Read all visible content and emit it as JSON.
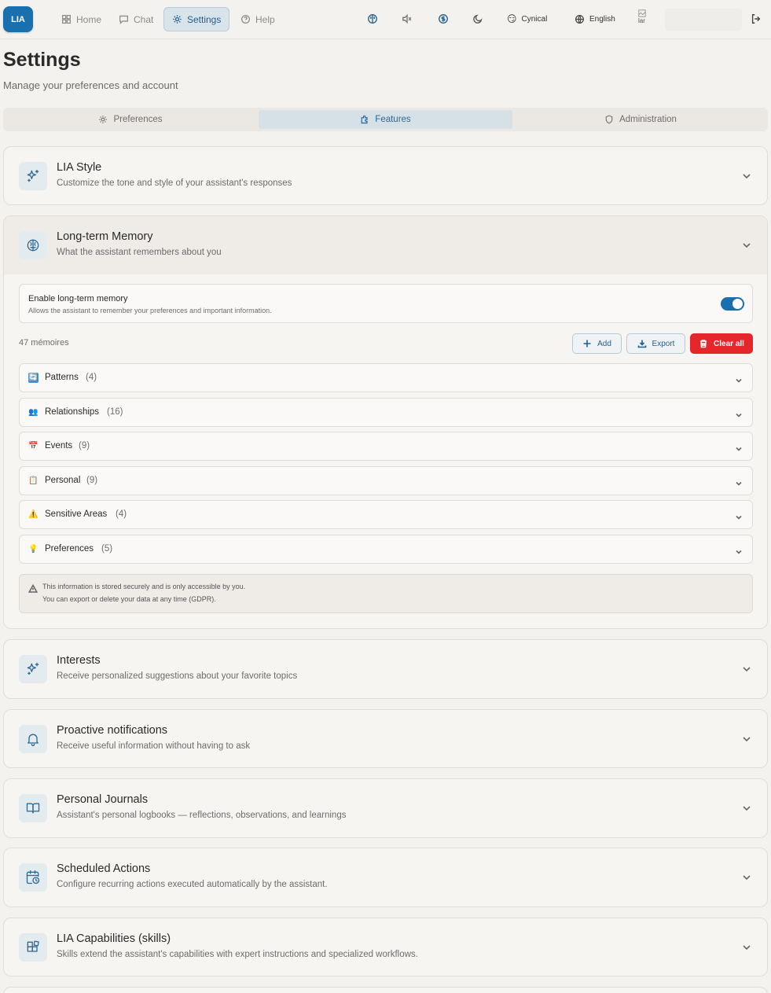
{
  "app": {
    "logo": "LIA"
  },
  "nav": {
    "home": "Home",
    "chat": "Chat",
    "settings": "Settings",
    "help": "Help",
    "personality": "Cynical",
    "language": "English",
    "avatar_alt": "lar"
  },
  "header": {
    "title": "Settings",
    "subtitle": "Manage your preferences and account"
  },
  "tabs": [
    {
      "label": "Preferences",
      "icon": "gear-icon"
    },
    {
      "label": "Features",
      "icon": "puzzle-icon"
    },
    {
      "label": "Administration",
      "icon": "shield-icon"
    }
  ],
  "active_tab": "Features",
  "sections": {
    "lia_style": {
      "title": "LIA Style",
      "desc": "Customize the tone and style of your assistant's responses",
      "icon": "sparkles-icon"
    },
    "memory": {
      "title": "Long-term Memory",
      "desc": "What the assistant remembers about you",
      "icon": "brain-icon"
    },
    "interests": {
      "title": "Interests",
      "desc": "Receive personalized suggestions about your favorite topics",
      "icon": "sparkles-icon"
    },
    "notifications": {
      "title": "Proactive notifications",
      "desc": "Receive useful information without having to ask",
      "icon": "bell-icon"
    },
    "journals": {
      "title": "Personal Journals",
      "desc": "Assistant's personal logbooks — reflections, observations, and learnings",
      "icon": "book-icon"
    },
    "scheduled": {
      "title": "Scheduled Actions",
      "desc": "Configure recurring actions executed automatically by the assistant.",
      "icon": "calendar-clock-icon"
    },
    "skills": {
      "title": "LIA Capabilities (skills)",
      "desc": "Skills extend the assistant's capabilities with expert instructions and specialized workflows.",
      "icon": "blocks-icon"
    }
  },
  "memory": {
    "toggle_label": "Enable long-term memory",
    "toggle_hint": "Allows the assistant to remember your preferences and important information.",
    "enabled": true,
    "count": "47 mémoires",
    "add": "Add",
    "export": "Export",
    "clear": "Clear all",
    "categories": [
      {
        "label": "Patterns",
        "count": "(4)",
        "emoji": "🔄"
      },
      {
        "label": "Relationships",
        "count": "(16)",
        "emoji": "👥"
      },
      {
        "label": "Events",
        "count": "(9)",
        "emoji": "📅"
      },
      {
        "label": "Personal",
        "count": "(9)",
        "emoji": "📋"
      },
      {
        "label": "Sensitive Areas",
        "count": "(4)",
        "emoji": "⚠️"
      },
      {
        "label": "Preferences",
        "count": "(5)",
        "emoji": "💡"
      }
    ],
    "notice_line1": "This information is stored securely and is only accessible by you.",
    "notice_line2": "You can export or delete your data at any time (GDPR)."
  },
  "colors": {
    "accent": "#1a6fae",
    "danger": "#e5262a"
  }
}
